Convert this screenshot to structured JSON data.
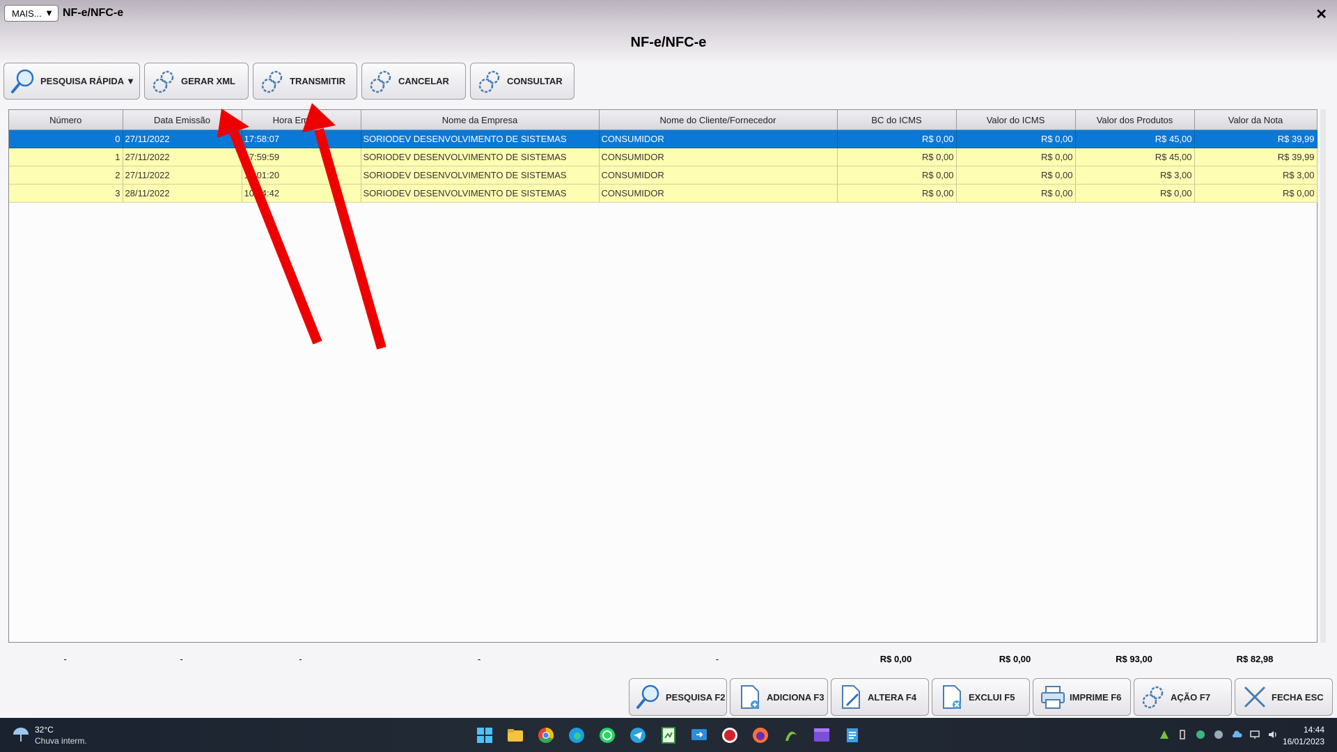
{
  "titlebar": {
    "mais_label": "MAIS...",
    "window_title": "NF-e/NFC-e",
    "close_glyph": "✕"
  },
  "page_title": "NF-e/NFC-e",
  "toolbar": {
    "pesquisa_rapida": "PESQUISA RÁPIDA",
    "gerar_xml": "GERAR XML",
    "transmitir": "TRANSMITIR",
    "cancelar": "CANCELAR",
    "consultar": "CONSULTAR"
  },
  "table": {
    "headers": [
      "Número",
      "Data Emissão",
      "Hora Emissão",
      "Nome da Empresa",
      "Nome do Cliente/Fornecedor",
      "BC do ICMS",
      "Valor do ICMS",
      "Valor dos Produtos",
      "Valor da Nota"
    ],
    "rows": [
      [
        "0",
        "27/11/2022",
        "17:58:07",
        "SORIODEV DESENVOLVIMENTO DE SISTEMAS",
        "CONSUMIDOR",
        "R$ 0,00",
        "R$ 0,00",
        "R$ 45,00",
        "R$ 39,99"
      ],
      [
        "1",
        "27/11/2022",
        "17:59:59",
        "SORIODEV DESENVOLVIMENTO DE SISTEMAS",
        "CONSUMIDOR",
        "R$ 0,00",
        "R$ 0,00",
        "R$ 45,00",
        "R$ 39,99"
      ],
      [
        "2",
        "27/11/2022",
        "18:01:20",
        "SORIODEV DESENVOLVIMENTO DE SISTEMAS",
        "CONSUMIDOR",
        "R$ 0,00",
        "R$ 0,00",
        "R$ 3,00",
        "R$ 3,00"
      ],
      [
        "3",
        "28/11/2022",
        "10:14:42",
        "SORIODEV DESENVOLVIMENTO DE SISTEMAS",
        "CONSUMIDOR",
        "R$ 0,00",
        "R$ 0,00",
        "R$ 0,00",
        "R$ 0,00"
      ]
    ],
    "selected_row": 0
  },
  "totals": [
    "-",
    "-",
    "-",
    "-",
    "-",
    "R$ 0,00",
    "R$ 0,00",
    "R$ 93,00",
    "R$ 82,98"
  ],
  "bottom_bar": {
    "pesquisa": "PESQUISA F2",
    "adiciona": "ADICIONA F3",
    "altera": "ALTERA F4",
    "exclui": "EXCLUI F5",
    "imprime": "IMPRIME F6",
    "acao": "AÇÃO F7",
    "fecha": "FECHA ESC"
  },
  "taskbar": {
    "weather_temp": "32°C",
    "weather_desc": "Chuva interm.",
    "time": "14:44",
    "date": "16/01/2023"
  },
  "colors": {
    "selected_row": "#0a78d7",
    "row_bg": "#fefeb2",
    "annotation_arrow": "#ee0000"
  }
}
